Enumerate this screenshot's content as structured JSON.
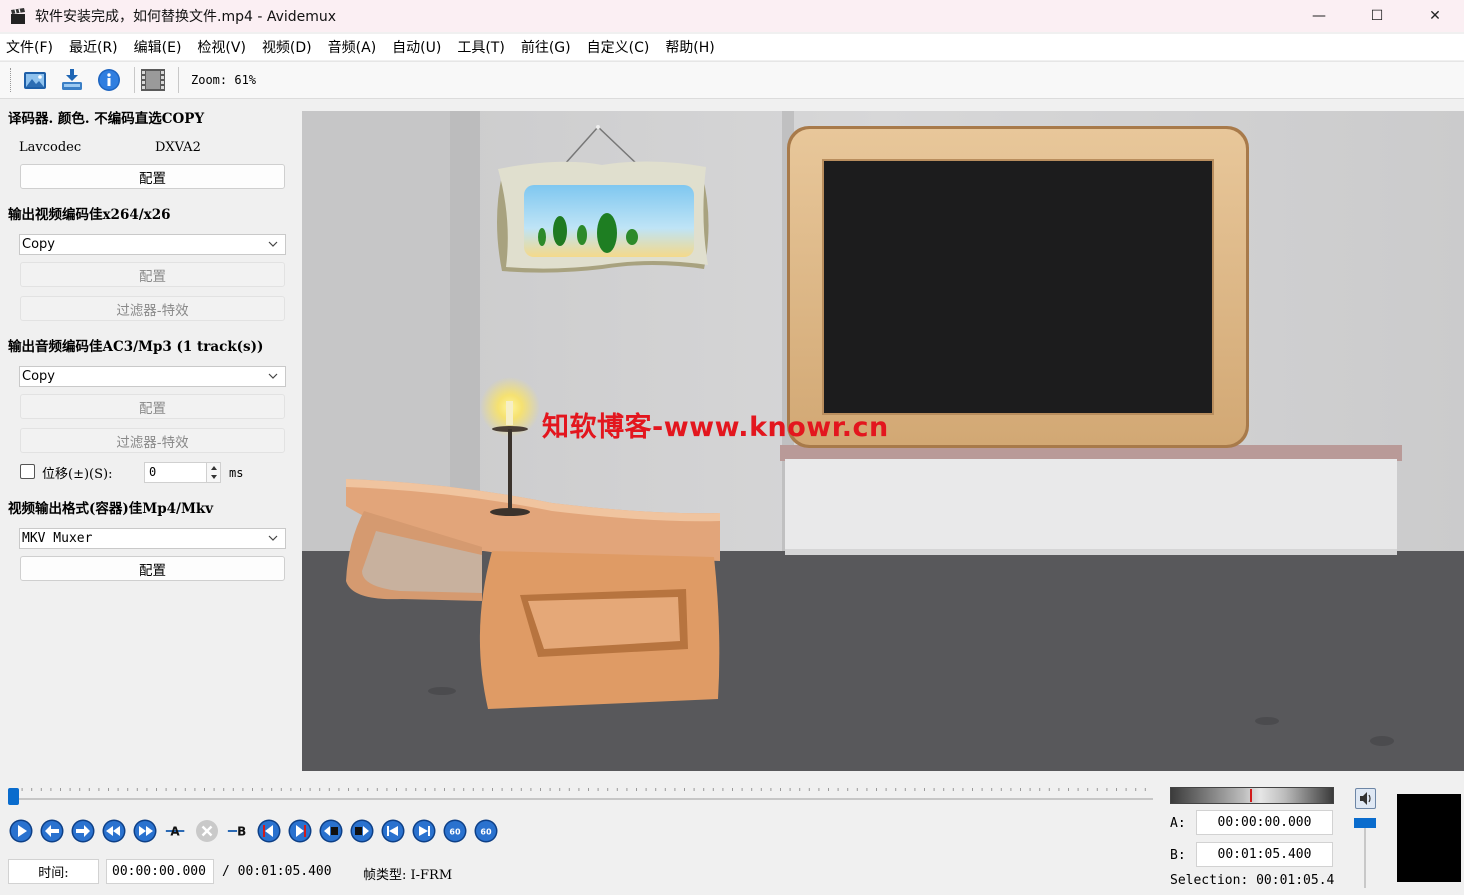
{
  "window": {
    "title": "软件安装完成，如何替换文件.mp4 - Avidemux",
    "minimize": "—",
    "maximize": "☐",
    "close": "✕"
  },
  "menu": [
    "文件(F)",
    "最近(R)",
    "编辑(E)",
    "检视(V)",
    "视频(D)",
    "音频(A)",
    "自动(U)",
    "工具(T)",
    "前往(G)",
    "自定义(C)",
    "帮助(H)"
  ],
  "toolbar": {
    "icons": [
      "open-image-icon",
      "save-icon",
      "info-icon",
      "film-icon"
    ],
    "zoom_text": "Zoom: 61%"
  },
  "decoder": {
    "title": "译码器. 颜色. 不编码直选COPY",
    "codec": "Lavcodec",
    "accel": "DXVA2",
    "config_label": "配置"
  },
  "video_output": {
    "title": "输出视频编码佳x264/x26",
    "selected": "Copy",
    "config_label": "配置",
    "filters_label": "过滤器-特效"
  },
  "audio_output": {
    "title": "输出音频编码佳AC3/Mp3 (1 track(s))",
    "selected": "Copy",
    "config_label": "配置",
    "filters_label": "过滤器-特效",
    "shift_label": "位移(±)(S):",
    "shift_value": "0",
    "shift_unit": "ms"
  },
  "container": {
    "title": "视频输出格式(容器)佳Mp4/Mkv",
    "selected": "MKV Muxer",
    "config_label": "配置"
  },
  "watermark": "知软博客-www.knowr.cn",
  "playback": {
    "time_label": "时间:",
    "current_time": "00:00:00.000",
    "total_time": "/ 00:01:05.400",
    "frame_type": "帧类型: I-FRM",
    "position_fraction": 0.0
  },
  "markers": {
    "a_label": "A:",
    "a_value": "00:00:00.000",
    "b_label": "B:",
    "b_value": "00:01:05.400",
    "selection_text": "Selection: 00:01:05.400"
  },
  "nav_icons": [
    "play-icon",
    "back-icon",
    "forward-icon",
    "rewind-icon",
    "fast-forward-icon",
    "set-marker-a-icon",
    "delete-icon",
    "set-marker-b-icon",
    "prev-cut-icon",
    "next-cut-icon",
    "prev-black-icon",
    "next-black-icon",
    "go-first-icon",
    "go-last-icon",
    "back-60-icon",
    "forward-60-icon"
  ],
  "colors": {
    "accent": "#0a6ccd",
    "watermark": "#e3161e"
  }
}
